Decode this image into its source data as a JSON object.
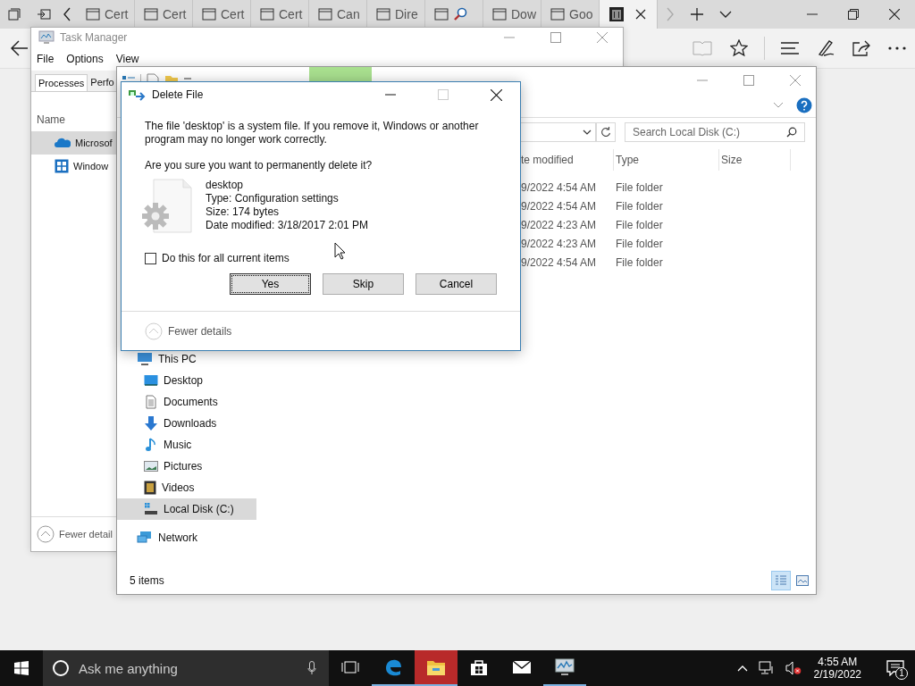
{
  "browser": {
    "tabs": [
      {
        "kind": "page",
        "label": "Cert",
        "selected": false
      },
      {
        "kind": "page",
        "label": "Cert",
        "selected": false
      },
      {
        "kind": "page",
        "label": "Cert",
        "selected": false
      },
      {
        "kind": "page",
        "label": "Cert",
        "selected": false
      },
      {
        "kind": "page",
        "label": "Can",
        "selected": false
      },
      {
        "kind": "page",
        "label": "Dire",
        "selected": false
      },
      {
        "kind": "search",
        "selected": false
      },
      {
        "kind": "page",
        "label": "Dow",
        "selected": false
      },
      {
        "kind": "page",
        "label": "Goo",
        "selected": false
      },
      {
        "kind": "pinned",
        "selected": true
      }
    ]
  },
  "task_manager": {
    "title": "Task Manager",
    "menu": [
      "File",
      "Options",
      "View"
    ],
    "tabs": [
      {
        "label": "Processes",
        "selected": true
      },
      {
        "label": "Perfo",
        "selected": false
      }
    ],
    "column": "Name",
    "rows": [
      {
        "kind": "cloud",
        "name": "Microsof",
        "selected": true
      },
      {
        "kind": "shield",
        "name": "Window",
        "selected": false
      }
    ],
    "footer": "Fewer detail"
  },
  "explorer": {
    "search": {
      "placeholder": "Search Local Disk (C:)"
    },
    "columns": [
      "te modified",
      "Type",
      "Size"
    ],
    "rows": [
      {
        "date": "9/2022 4:54 AM",
        "type": "File folder"
      },
      {
        "date": "9/2022 4:54 AM",
        "type": "File folder"
      },
      {
        "date": "9/2022 4:23 AM",
        "type": "File folder"
      },
      {
        "date": "9/2022 4:23 AM",
        "type": "File folder"
      },
      {
        "date": "9/2022 4:54 AM",
        "type": "File folder"
      }
    ],
    "nav": [
      {
        "kind": "pc",
        "label": "This PC",
        "selected": false,
        "children": [
          {
            "kind": "desktop",
            "label": "Desktop",
            "selected": false
          },
          {
            "kind": "documents",
            "label": "Documents",
            "selected": false
          },
          {
            "kind": "downloads",
            "label": "Downloads",
            "selected": false
          },
          {
            "kind": "music",
            "label": "Music",
            "selected": false
          },
          {
            "kind": "pictures",
            "label": "Pictures",
            "selected": false
          },
          {
            "kind": "videos",
            "label": "Videos",
            "selected": false
          },
          {
            "kind": "disk",
            "label": "Local Disk (C:)",
            "selected": true
          }
        ]
      },
      {
        "kind": "network",
        "label": "Network",
        "selected": false
      }
    ],
    "status": "5 items",
    "views": [
      {
        "kind": "details",
        "selected": true
      },
      {
        "kind": "tiles",
        "selected": false
      }
    ]
  },
  "dialog": {
    "title": "Delete File",
    "message": "The file 'desktop' is a system file. If you remove it, Windows or another program may no longer work correctly.",
    "question": "Are you sure you want to permanently delete it?",
    "file": {
      "name": "desktop",
      "details": [
        "Type: Configuration settings",
        "Size: 174 bytes",
        "Date modified: 3/18/2017 2:01 PM"
      ]
    },
    "checkbox": {
      "label": "Do this for all current items",
      "checked": false
    },
    "buttons": [
      {
        "label": "Yes",
        "focused": true
      },
      {
        "label": "Skip",
        "focused": false
      },
      {
        "label": "Cancel",
        "focused": false
      }
    ],
    "details_toggle": "Fewer details"
  },
  "taskbar": {
    "search": {
      "placeholder": "Ask me anything"
    },
    "apps": [
      {
        "kind": "edge",
        "running": true,
        "flashing": false
      },
      {
        "kind": "explorer",
        "running": true,
        "flashing": true
      },
      {
        "kind": "store",
        "running": false,
        "flashing": false
      },
      {
        "kind": "mail",
        "running": false,
        "flashing": false
      },
      {
        "kind": "taskmgr",
        "running": true,
        "flashing": false
      }
    ],
    "time": "4:55 AM",
    "date": "2/19/2022",
    "notifications": "1"
  }
}
